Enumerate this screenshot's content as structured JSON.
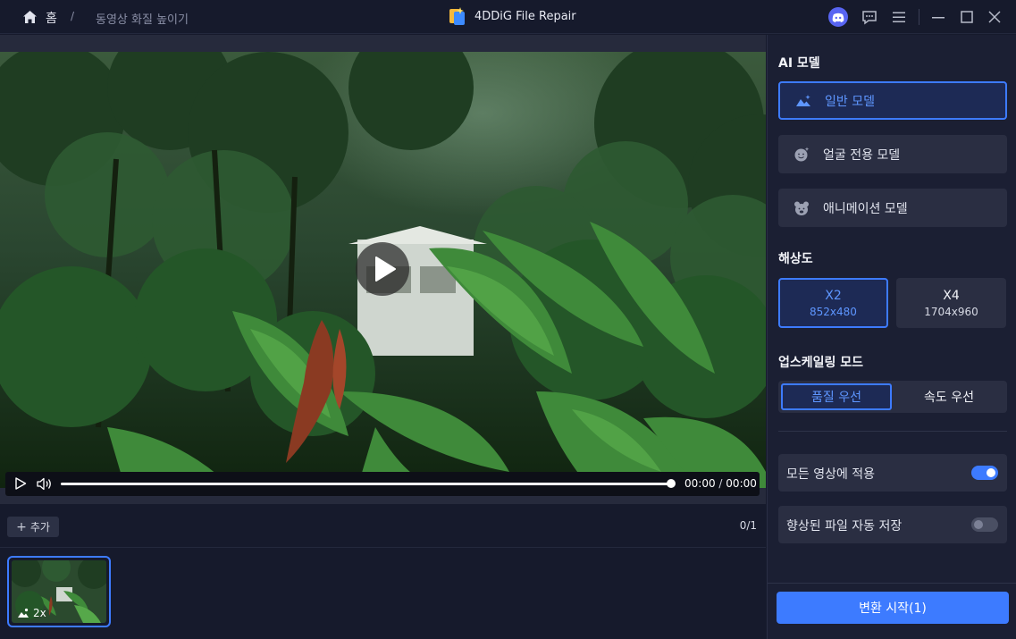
{
  "titlebar": {
    "home_label": "홈",
    "separator": "/",
    "breadcrumb": "동영상 화질 높이기",
    "app_title": "4DDiG File Repair"
  },
  "player": {
    "time_current": "00:00",
    "time_separator": "/",
    "time_total": "00:00",
    "progress": 1.0
  },
  "toolbar": {
    "add_label": "추가",
    "count": "0/1"
  },
  "thumbnails": [
    {
      "badge": "2x",
      "selected": true
    }
  ],
  "panel": {
    "ai_model_title": "AI 모델",
    "models": [
      {
        "label": "일반 모델",
        "icon": "landscape-icon",
        "active": true
      },
      {
        "label": "얼굴 전용 모델",
        "icon": "face-icon",
        "active": false
      },
      {
        "label": "애니메이션 모델",
        "icon": "bear-icon",
        "active": false
      }
    ],
    "resolution_title": "해상도",
    "resolutions": [
      {
        "label": "X2",
        "size": "852x480",
        "active": true
      },
      {
        "label": "X4",
        "size": "1704x960",
        "active": false
      }
    ],
    "mode_title": "업스케일링 모드",
    "modes": [
      {
        "label": "품질 우선",
        "active": true
      },
      {
        "label": "속도 우선",
        "active": false
      }
    ],
    "toggles": [
      {
        "label": "모든 영상에 적용",
        "on": true
      },
      {
        "label": "향상된 파일 자동 저장",
        "on": false
      }
    ],
    "start_label": "변환 시작(1)"
  },
  "colors": {
    "accent": "#3d7bff",
    "panel_bg": "#1b1f33",
    "button_bg": "#2a2e42"
  }
}
